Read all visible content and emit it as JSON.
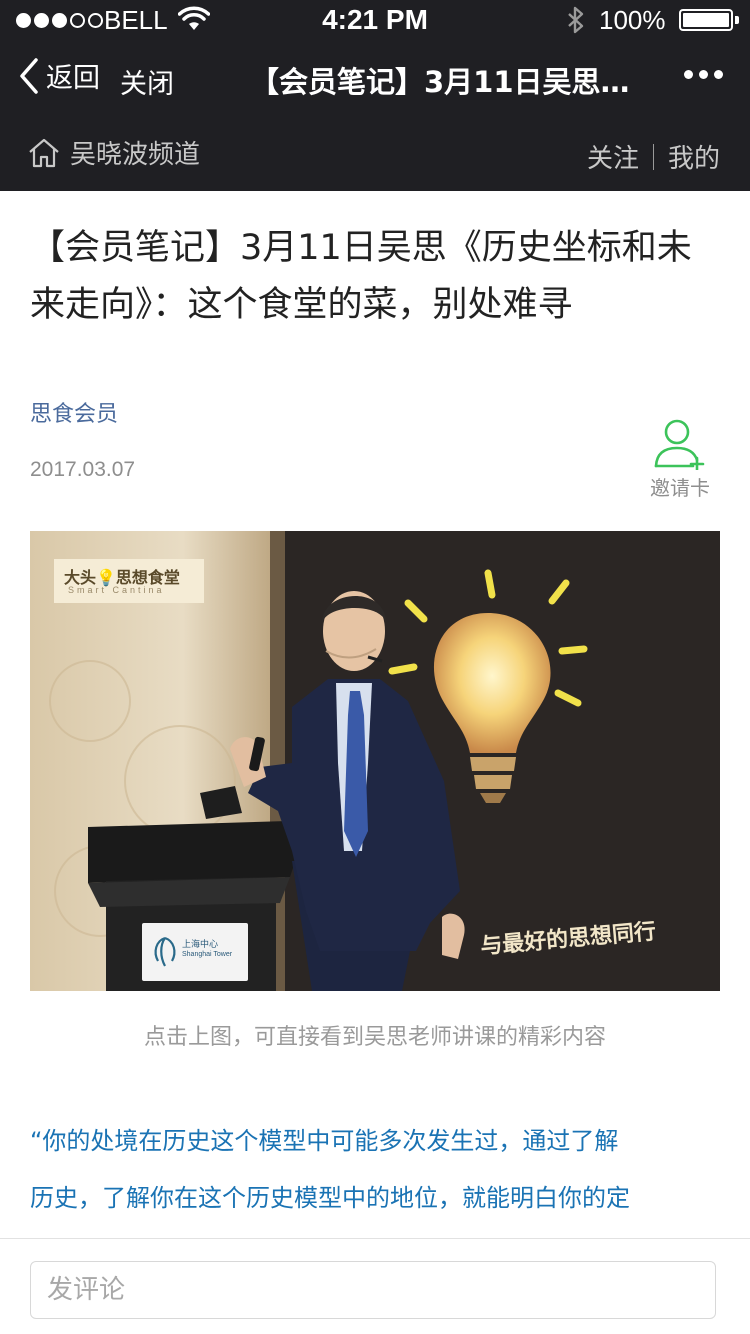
{
  "status_bar": {
    "carrier": "BELL",
    "time": "4:21 PM",
    "battery": "100%",
    "battery_level": 1.0,
    "signal_bars_filled": 3,
    "signal_bars_total": 5
  },
  "nav": {
    "back_label": "返回",
    "close_label": "关闭",
    "title": "【会员笔记】3月11日吴思《历史坐标和未来走向》：这个食堂的菜，别处难寻",
    "more_icon": "more-dots-icon"
  },
  "channel": {
    "home_icon": "home-icon",
    "name": "吴晓波频道",
    "follow_label": "关注",
    "mine_label": "我的"
  },
  "article": {
    "title": "【会员笔记】3月11日吴思《历史坐标和未来走向》：这个食堂的菜，别处难寻",
    "author": "思食会员",
    "date": "2017.03.07",
    "invite_label": "邀请卡",
    "invite_icon": "user-add-icon",
    "image": {
      "logo_text": "大头💡思想食堂",
      "logo_subtext": "Smart Cantina",
      "slogan": "与最好的思想同行",
      "podium_text": "上海中心",
      "podium_subtext": "Shanghai Tower"
    },
    "caption": "点击上图，可直接看到吴思老师讲课的精彩内容",
    "quote_lines": [
      "“你的处境在历史这个模型中可能多次发生过，通过了解",
      "历史，了解你在这个历史模型中的地位，就能明白你的定"
    ]
  },
  "comment": {
    "placeholder": "发评论"
  },
  "colors": {
    "header_bg": "#1f1f23",
    "link_blue": "#4a6a9c",
    "quote_blue": "#1a73b4",
    "invite_green": "#3cc35a"
  }
}
